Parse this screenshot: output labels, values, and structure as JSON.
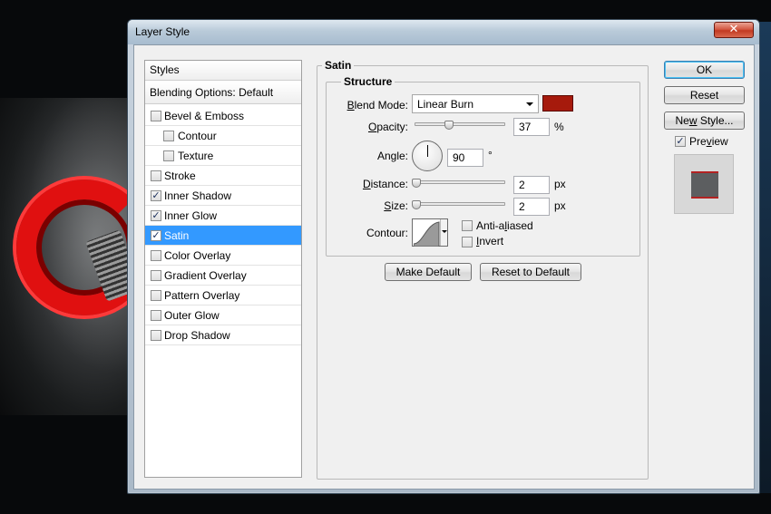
{
  "window": {
    "title": "Layer Style",
    "close_glyph": "✕"
  },
  "styles_list": {
    "header_styles": "Styles",
    "header_blending": "Blending Options: Default",
    "items": [
      {
        "label": "Bevel & Emboss",
        "checked": false,
        "indent": false
      },
      {
        "label": "Contour",
        "checked": false,
        "indent": true
      },
      {
        "label": "Texture",
        "checked": false,
        "indent": true
      },
      {
        "label": "Stroke",
        "checked": false,
        "indent": false
      },
      {
        "label": "Inner Shadow",
        "checked": true,
        "indent": false
      },
      {
        "label": "Inner Glow",
        "checked": true,
        "indent": false
      },
      {
        "label": "Satin",
        "checked": true,
        "indent": false,
        "selected": true
      },
      {
        "label": "Color Overlay",
        "checked": false,
        "indent": false
      },
      {
        "label": "Gradient Overlay",
        "checked": false,
        "indent": false
      },
      {
        "label": "Pattern Overlay",
        "checked": false,
        "indent": false
      },
      {
        "label": "Outer Glow",
        "checked": false,
        "indent": false
      },
      {
        "label": "Drop Shadow",
        "checked": false,
        "indent": false
      }
    ]
  },
  "satin": {
    "group_title": "Satin",
    "structure_title": "Structure",
    "blend_mode": {
      "label_mn": "B",
      "label_rest": "lend Mode:",
      "value": "Linear Burn",
      "color": "#a61a0c"
    },
    "opacity": {
      "label_mn": "O",
      "label_rest": "pacity:",
      "value": "37",
      "unit": "%",
      "level": 0.37
    },
    "angle": {
      "label": "Angle:",
      "value": "90",
      "unit": "°"
    },
    "distance": {
      "label_mn": "D",
      "label_rest": "istance:",
      "value": "2",
      "unit": "px",
      "level": 0.01
    },
    "size": {
      "label_mn": "S",
      "label_rest": "ize:",
      "value": "2",
      "unit": "px",
      "level": 0.01
    },
    "contour": {
      "label": "Contour:"
    },
    "anti_aliased": {
      "label_pre": "Anti-a",
      "label_mn": "l",
      "label_post": "iased",
      "checked": false
    },
    "invert": {
      "label_mn": "I",
      "label_rest": "nvert",
      "checked": false
    },
    "make_default": "Make Default",
    "reset_to_default": "Reset to Default"
  },
  "actions": {
    "ok": "OK",
    "reset": "Reset",
    "new_style_pre": "Ne",
    "new_style_mn": "w",
    "new_style_post": " Style...",
    "preview_pre": "Pre",
    "preview_mn": "v",
    "preview_post": "iew",
    "preview_checked": true
  },
  "check_glyph": "✓"
}
